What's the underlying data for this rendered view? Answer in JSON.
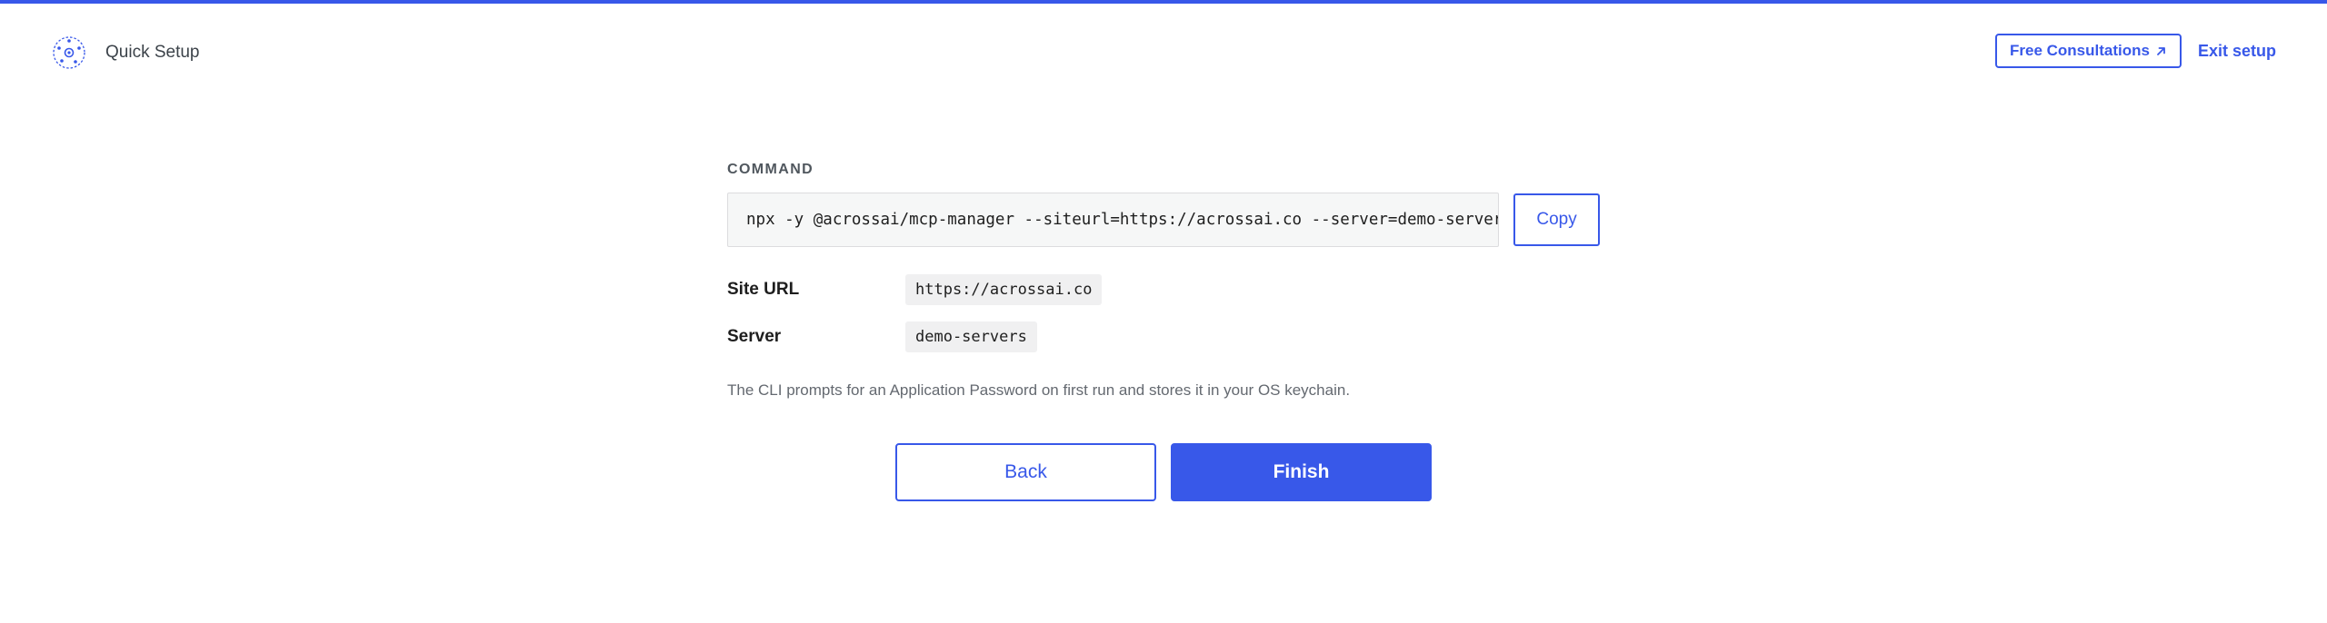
{
  "header": {
    "title": "Quick Setup",
    "logo_icon": "network-nodes-icon",
    "consultations_label": "Free Consultations",
    "consultations_icon": "arrow-up-right-icon",
    "exit_label": "Exit setup"
  },
  "command": {
    "label": "COMMAND",
    "text": "npx -y @acrossai/mcp-manager --siteurl=https://acrossai.co --server=demo-servers",
    "copy_label": "Copy"
  },
  "details": [
    {
      "label": "Site URL",
      "value": "https://acrossai.co"
    },
    {
      "label": "Server",
      "value": "demo-servers"
    }
  ],
  "help_text": "The CLI prompts for an Application Password on first run and stores it in your OS keychain.",
  "actions": {
    "back_label": "Back",
    "finish_label": "Finish"
  },
  "colors": {
    "accent": "#3858e9",
    "muted_text": "#646970",
    "code_bg": "#f6f7f7"
  }
}
